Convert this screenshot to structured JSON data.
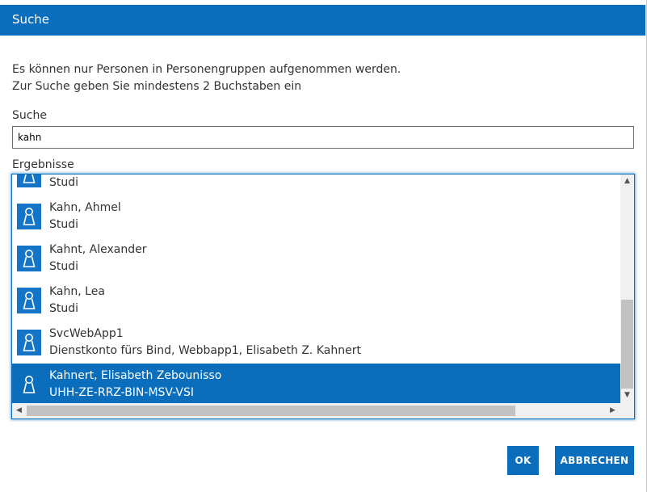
{
  "dialog": {
    "title": "Suche",
    "info_line1": "Es können nur Personen in Personengruppen aufgenommen werden.",
    "info_line2": "Zur Suche geben Sie mindestens 2 Buchstaben ein",
    "search_label": "Suche",
    "search_value": "kahn",
    "results_label": "Ergebnisse",
    "ok_label": "OK",
    "cancel_label": "ABBRECHEN"
  },
  "results": [
    {
      "name": "",
      "sub": "Studi"
    },
    {
      "name": "Kahn, Ahmel",
      "sub": "Studi"
    },
    {
      "name": "Kahnt, Alexander",
      "sub": "Studi"
    },
    {
      "name": "Kahn, Lea",
      "sub": "Studi"
    },
    {
      "name": "SvcWebApp1",
      "sub": "Dienstkonto fürs Bind, Webbapp1, Elisabeth Z. Kahnert"
    },
    {
      "name": "Kahnert, Elisabeth Zebounisso",
      "sub": "UHH-ZE-RRZ-BIN-MSV-VSI",
      "selected": true
    }
  ],
  "colors": {
    "accent": "#0a6ebd",
    "avatar": "#1474c8",
    "text": "#333333"
  },
  "icons": {
    "result_item": "person-icon"
  }
}
